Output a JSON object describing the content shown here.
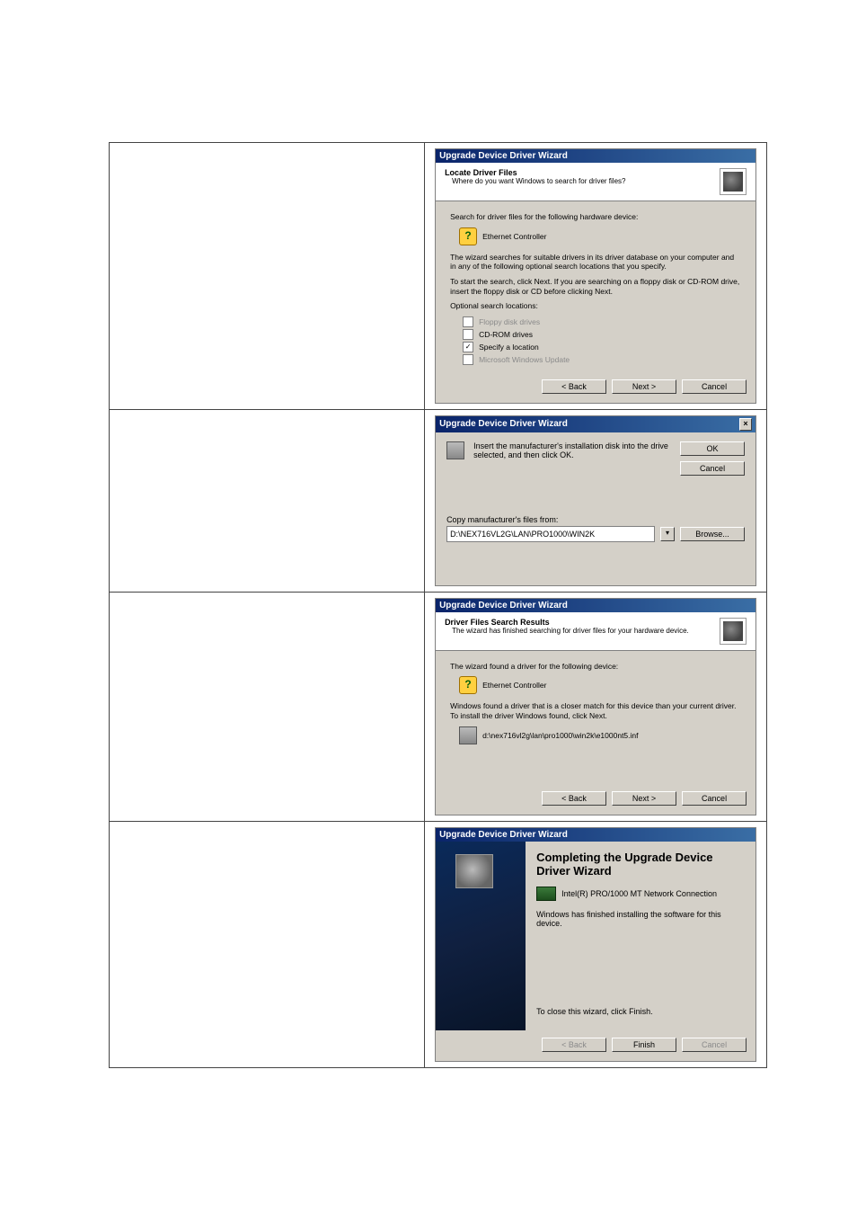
{
  "d1": {
    "title_bar": "Upgrade Device Driver Wizard",
    "head_title": "Locate Driver Files",
    "head_sub": "Where do you want Windows to search for driver files?",
    "line1": "Search for driver files for the following hardware device:",
    "device": "Ethernet Controller",
    "para1": "The wizard searches for suitable drivers in its driver database on your computer and in any of the following optional search locations that you specify.",
    "para2": "To start the search, click Next. If you are searching on a floppy disk or CD-ROM drive, insert the floppy disk or CD before clicking Next.",
    "opt_label": "Optional search locations:",
    "opt1": "Floppy disk drives",
    "opt2": "CD-ROM drives",
    "opt3": "Specify a location",
    "opt4": "Microsoft Windows Update",
    "back": "< Back",
    "next": "Next >",
    "cancel": "Cancel"
  },
  "d2": {
    "title_bar": "Upgrade Device Driver Wizard",
    "msg": "Insert the manufacturer's installation disk into the drive selected, and then click OK.",
    "ok": "OK",
    "cancel": "Cancel",
    "copy_label": "Copy manufacturer's files from:",
    "path": "D:\\NEX716VL2G\\LAN\\PRO1000\\WIN2K",
    "browse": "Browse..."
  },
  "d3": {
    "title_bar": "Upgrade Device Driver Wizard",
    "head_title": "Driver Files Search Results",
    "head_sub": "The wizard has finished searching for driver files for your hardware device.",
    "found_line": "The wizard found a driver for the following device:",
    "device": "Ethernet Controller",
    "closer_line": "Windows found a driver that is a closer match for this device than your current driver. To install the driver Windows found, click Next.",
    "inf_path": "d:\\nex716vl2g\\lan\\pro1000\\win2k\\e1000nt5.inf",
    "back": "< Back",
    "next": "Next >",
    "cancel": "Cancel"
  },
  "d4": {
    "title_bar": "Upgrade Device Driver Wizard",
    "complete_title": "Completing the Upgrade Device Driver Wizard",
    "nic": "Intel(R) PRO/1000 MT Network Connection",
    "done_line": "Windows has finished installing the software for this device.",
    "close_line": "To close this wizard, click Finish.",
    "back": "< Back",
    "finish": "Finish",
    "cancel": "Cancel"
  }
}
